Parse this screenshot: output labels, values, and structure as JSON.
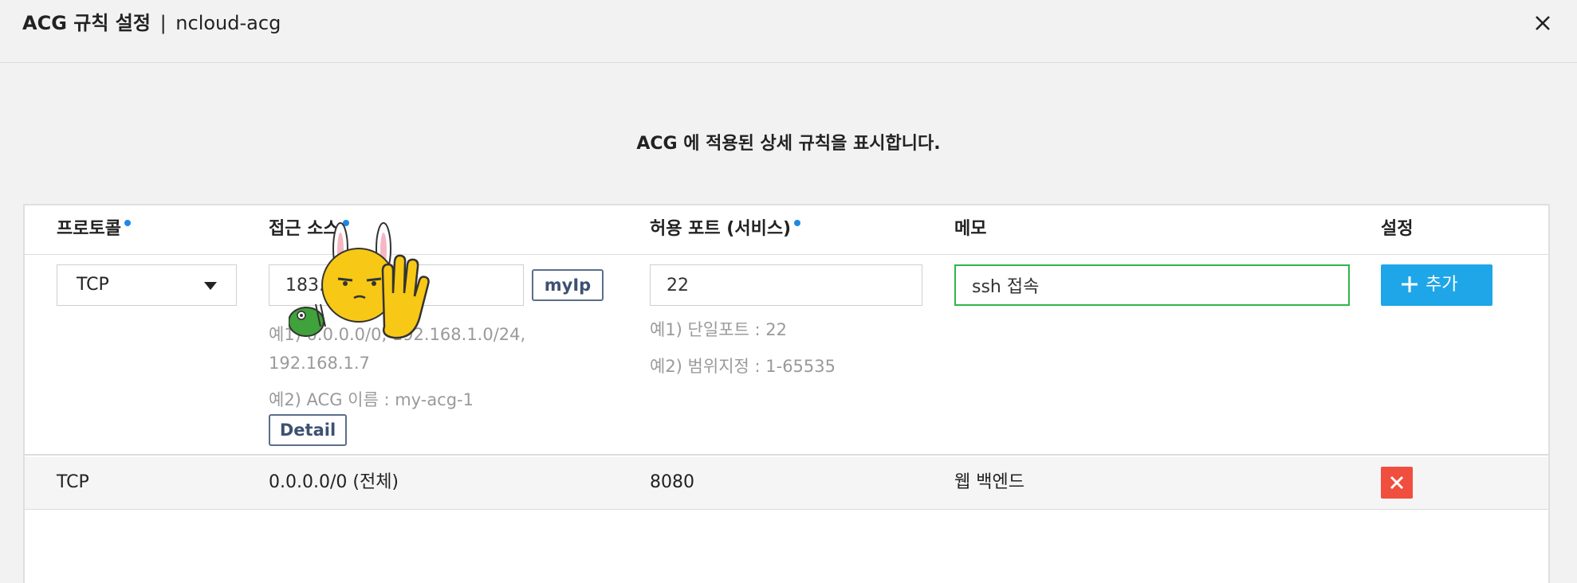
{
  "modal": {
    "title_bold": "ACG 규칙 설정",
    "title_sep": "|",
    "title_name": "ncloud-acg",
    "close_icon": "close-icon"
  },
  "description": "ACG 에 적용된 상세 규칙을 표시합니다.",
  "columns": {
    "protocol": "프로토콜",
    "source": "접근 소스",
    "port": "허용 포트 (서비스)",
    "memo": "메모",
    "settings": "설정"
  },
  "form": {
    "protocol_value": "TCP",
    "source_value": "183.",
    "myip_label": "myIp",
    "source_hint_1": "예1) 0.0.0.0/0, 192.168.1.0/24,",
    "source_hint_1b": "192.168.1.7",
    "source_hint_2": "예2) ACG 이름 : my-acg-1",
    "detail_label": "Detail",
    "port_value": "22",
    "port_hint_1": "예1) 단일포트 : 22",
    "port_hint_2": "예2) 범위지정 : 1-65535",
    "memo_value": "ssh 접속",
    "add_label": "추가"
  },
  "rules": [
    {
      "protocol": "TCP",
      "source": "0.0.0.0/0 (전체)",
      "port": "8080",
      "memo": "웹 백엔드"
    }
  ],
  "colors": {
    "accent": "#1fa6e8",
    "required_dot": "#1e88e5",
    "delete": "#f04e3e",
    "focus": "#2fb54a"
  }
}
